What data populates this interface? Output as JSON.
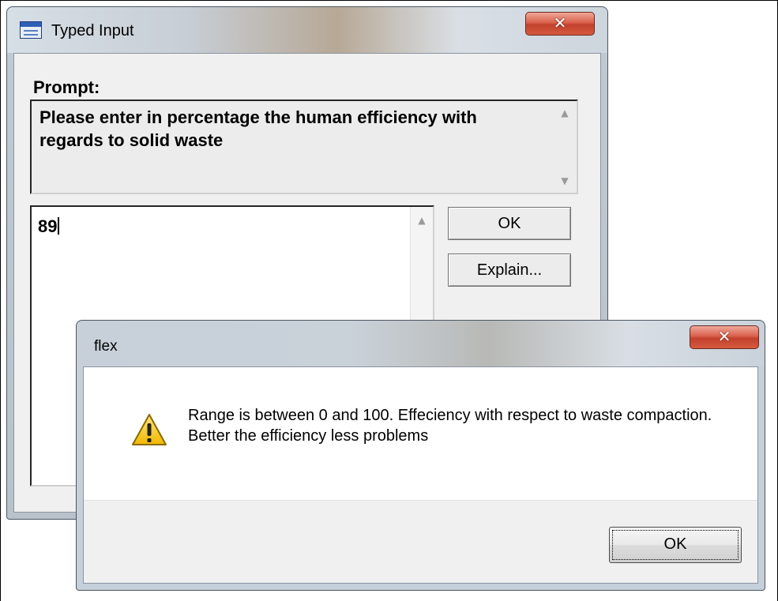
{
  "typed_input_window": {
    "title": "Typed Input",
    "close_glyph": "✕",
    "prompt_label": "Prompt:",
    "prompt_text": "Please enter in percentage the human efficiency with regards to solid waste",
    "input_value": "89",
    "ok_label": "OK",
    "explain_label": "Explain...",
    "scroll_up_glyph": "▲",
    "scroll_down_glyph": "▼"
  },
  "flex_dialog": {
    "title": "flex",
    "close_glyph": "✕",
    "icon": "warning-icon",
    "message": "Range is between 0 and 100. Effeciency with respect to waste compaction. Better the efficiency less problems",
    "ok_label": "OK"
  },
  "colors": {
    "close_button": "#c9432f",
    "warning_fill": "#f5c400",
    "dialog_client": "#f0f0f0"
  }
}
